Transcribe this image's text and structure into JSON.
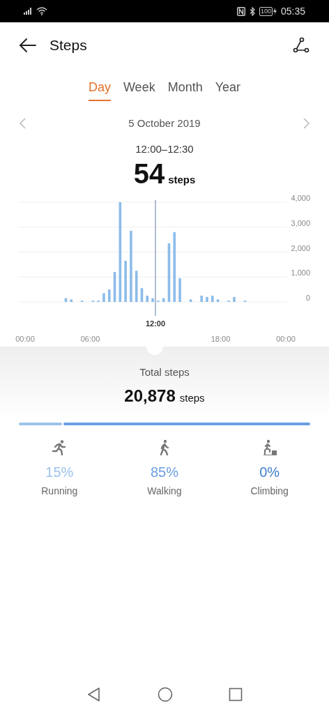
{
  "status_bar": {
    "battery": "100",
    "time": "05:35"
  },
  "header": {
    "title": "Steps"
  },
  "tabs": [
    {
      "label": "Day",
      "selected": true
    },
    {
      "label": "Week",
      "selected": false
    },
    {
      "label": "Month",
      "selected": false
    },
    {
      "label": "Year",
      "selected": false
    }
  ],
  "date_nav": {
    "date": "5 October 2019"
  },
  "selection": {
    "range": "12:00–12:30",
    "value": "54",
    "unit": "steps"
  },
  "chart_data": {
    "type": "bar",
    "grid": true,
    "x": [
      0.25,
      0.75,
      1.25,
      1.75,
      2.25,
      2.75,
      3.25,
      3.75,
      4.25,
      4.75,
      5.25,
      5.75,
      6.25,
      6.75,
      7.25,
      7.75,
      8.25,
      8.75,
      9.25,
      9.75,
      10.25,
      10.75,
      11.25,
      11.75,
      12.25,
      12.75,
      13.25,
      13.75,
      14.25,
      14.75,
      15.25,
      15.75,
      16.25,
      16.75,
      17.25,
      17.75,
      18.25,
      18.75,
      19.25,
      19.75,
      20.25,
      20.75,
      21.25,
      21.75,
      22.25,
      22.75,
      23.25,
      23.75
    ],
    "series": [
      {
        "color": "#8cbcea",
        "values": [
          0,
          0,
          0,
          0,
          0,
          0,
          0,
          150,
          100,
          0,
          50,
          0,
          50,
          50,
          350,
          500,
          1200,
          4000,
          1650,
          2850,
          1250,
          550,
          250,
          150,
          50,
          150,
          2350,
          2800,
          950,
          0,
          100,
          0,
          250,
          200,
          250,
          100,
          0,
          50,
          200,
          0,
          50,
          0,
          0,
          0,
          0,
          0,
          0,
          0
        ]
      }
    ],
    "ref_lines": [
      {
        "axis": "x",
        "value": 12
      }
    ],
    "annotations": [
      "12:00"
    ],
    "ylim": [
      0,
      4000
    ],
    "yticks": [
      {
        "value": 0,
        "label": "0"
      },
      {
        "value": 1000,
        "label": "1,000"
      },
      {
        "value": 2000,
        "label": "2,000"
      },
      {
        "value": 3000,
        "label": "3,000"
      },
      {
        "value": 4000,
        "label": "4,000"
      }
    ],
    "xlim": [
      0,
      24
    ],
    "xticks": [
      {
        "value": 0,
        "label": "00:00"
      },
      {
        "value": 6,
        "label": "06:00"
      },
      {
        "value": 18,
        "label": "18:00"
      },
      {
        "value": 24,
        "label": "00:00"
      }
    ]
  },
  "total": {
    "label": "Total steps",
    "value": "20,878",
    "unit": "steps"
  },
  "activities": [
    {
      "kind": "running",
      "percent": "15%",
      "label": "Running",
      "color": "#9cc3ec"
    },
    {
      "kind": "walking",
      "percent": "85%",
      "label": "Walking",
      "color": "#6b9fe2"
    },
    {
      "kind": "climbing",
      "percent": "0%",
      "label": "Climbing",
      "color": "#3f7ccc"
    }
  ]
}
